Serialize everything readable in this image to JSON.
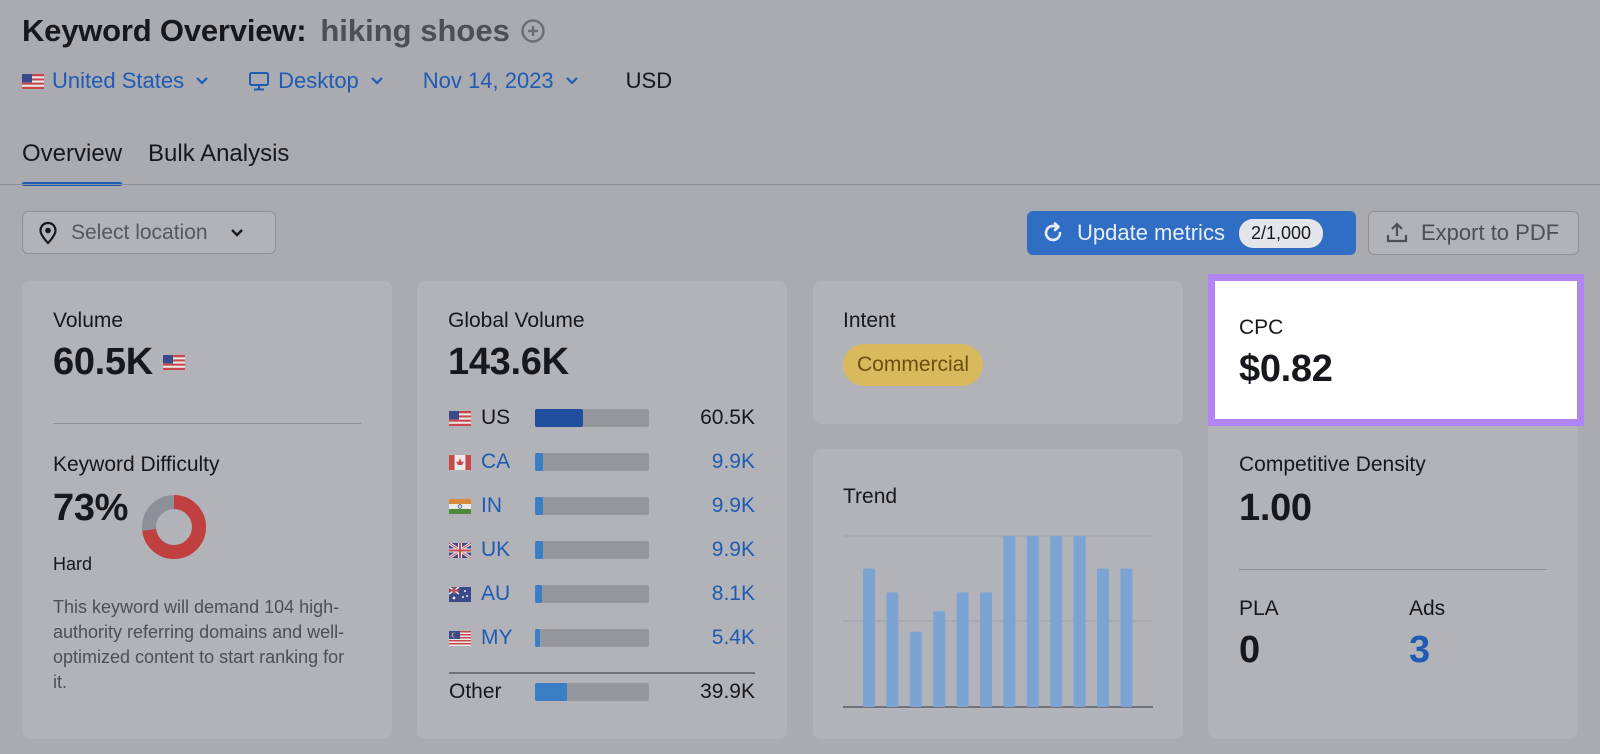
{
  "header": {
    "title": "Keyword Overview:",
    "keyword": "hiking shoes",
    "filters": {
      "country": "United States",
      "device": "Desktop",
      "date": "Nov 14, 2023",
      "currency": "USD"
    }
  },
  "tabs": [
    {
      "label": "Overview",
      "active": true
    },
    {
      "label": "Bulk Analysis",
      "active": false
    }
  ],
  "controls": {
    "location_placeholder": "Select location",
    "update_label": "Update metrics",
    "update_count": "2/1,000",
    "export_label": "Export to PDF"
  },
  "volume": {
    "label": "Volume",
    "value": "60.5K"
  },
  "difficulty": {
    "label": "Keyword Difficulty",
    "value": "73%",
    "percent": 73,
    "level": "Hard",
    "description": "This keyword will demand 104 high-authority referring domains and well-optimized content to start ranking for it."
  },
  "global_volume": {
    "label": "Global Volume",
    "value": "143.6K",
    "rows": [
      {
        "code": "US",
        "value": "60.5K",
        "share": 0.42
      },
      {
        "code": "CA",
        "value": "9.9K",
        "share": 0.07
      },
      {
        "code": "IN",
        "value": "9.9K",
        "share": 0.07
      },
      {
        "code": "UK",
        "value": "9.9K",
        "share": 0.07
      },
      {
        "code": "AU",
        "value": "8.1K",
        "share": 0.06
      },
      {
        "code": "MY",
        "value": "5.4K",
        "share": 0.04
      }
    ],
    "other": {
      "label": "Other",
      "value": "39.9K",
      "share": 0.28
    }
  },
  "intent": {
    "label": "Intent",
    "value": "Commercial"
  },
  "trend": {
    "label": "Trend",
    "values": [
      0.81,
      0.67,
      0.44,
      0.56,
      0.67,
      0.67,
      1.0,
      1.0,
      1.0,
      1.0,
      0.81,
      0.81
    ]
  },
  "cpc": {
    "label": "CPC",
    "value": "$0.82"
  },
  "competitive_density": {
    "label": "Competitive Density",
    "value": "1.00"
  },
  "pla": {
    "label": "PLA",
    "value": "0"
  },
  "ads": {
    "label": "Ads",
    "value": "3"
  },
  "colors": {
    "accent": "#1f5bb3",
    "difficulty": "#c0403f",
    "highlight": "#b084f3",
    "trend_bar": "#7ba4d3",
    "intent_badge": "#d8b95e"
  }
}
